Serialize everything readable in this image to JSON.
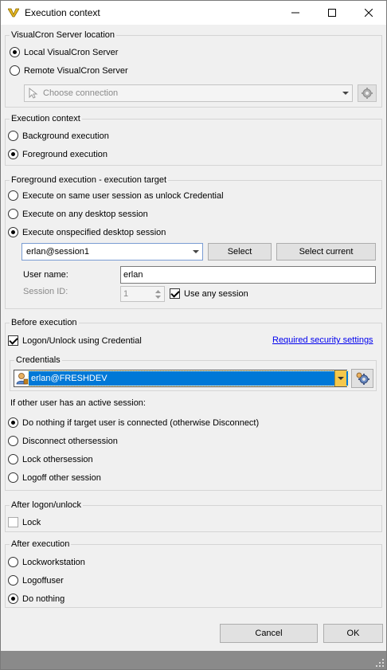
{
  "window": {
    "title": "Execution context"
  },
  "server_location": {
    "legend": "VisualCron Server location",
    "local_label": "Local VisualCron Server",
    "remote_label": "Remote VisualCron Server",
    "connection_placeholder": "Choose connection",
    "selected": "local"
  },
  "execution_context": {
    "legend": "Execution context",
    "background_label": "Background execution",
    "foreground_label": "Foreground execution",
    "selected": "foreground"
  },
  "foreground_target": {
    "legend": "Foreground execution - execution target",
    "option_same_session": "Execute on same user session as unlock Credential",
    "option_any_desktop": "Execute on any desktop session",
    "option_specified": "Execute onspecified desktop session",
    "selected": "specified",
    "session_combo_value": "erlan@session1",
    "select_button": "Select",
    "select_current_button": "Select current",
    "user_name_label": "User name:",
    "user_name_value": "erlan",
    "session_id_label": "Session ID:",
    "session_id_value": "1",
    "use_any_session_label": "Use any session",
    "use_any_session_checked": true
  },
  "before_execution": {
    "legend": "Before execution",
    "logon_unlock_label": "Logon/Unlock using Credential",
    "logon_unlock_checked": true,
    "required_security_link": "Required security settings",
    "credentials_legend": "Credentials",
    "credential_value": "erlan@FRESHDEV",
    "other_user_label": "If other user has an active session:",
    "option_do_nothing": "Do nothing if target user is connected (otherwise Disconnect)",
    "option_disconnect": "Disconnect othersession",
    "option_lock": "Lock othersession",
    "option_logoff": "Logoff other session",
    "selected": "do_nothing"
  },
  "after_logon": {
    "legend": "After logon/unlock",
    "lock_label": "Lock",
    "lock_checked": false
  },
  "after_execution": {
    "legend": "After execution",
    "option_lock_workstation": "Lockworkstation",
    "option_logoff_user": "Logoffuser",
    "option_do_nothing": "Do nothing",
    "selected": "do_nothing"
  },
  "footer": {
    "cancel_label": "Cancel",
    "ok_label": "OK"
  },
  "colors": {
    "selection_blue": "#0078d7",
    "dropdown_gold": "#f5c84c",
    "link_blue": "#0000ee"
  }
}
